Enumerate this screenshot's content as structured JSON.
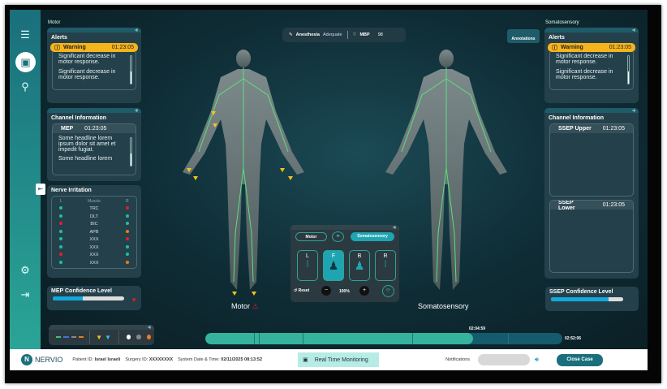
{
  "sidebar": {
    "items": [
      {
        "icon": "menu-icon"
      },
      {
        "icon": "monitor-icon",
        "active": true
      },
      {
        "icon": "search-analysis-icon"
      },
      {
        "icon": "user-settings-icon"
      },
      {
        "icon": "logout-icon"
      }
    ],
    "collapse_icon": "collapse-icon"
  },
  "vitals": {
    "anesthesia_label": "Anesthesia",
    "anesthesia_value": "Adequate",
    "mbp_label": "MBP",
    "mbp_value": "98"
  },
  "left": {
    "section_label": "Motor",
    "alerts": {
      "title": "Alerts",
      "level": "Warning",
      "time": "01:23:05",
      "messages": [
        "Significant decrease in motor response.",
        "Significant decrease in motor response."
      ]
    },
    "channel": {
      "title": "Channel Information",
      "name": "MEP",
      "time": "01:23:05",
      "lines": [
        "Some headline lorem ipsum dolor sit amet et impedit fugiat.",
        "Some headline lorem"
      ]
    },
    "nerve": {
      "title": "Nerve Irritation",
      "headers": [
        "L",
        "Muscle",
        "R"
      ],
      "rows": [
        {
          "l": "#1fbf9f",
          "m": "TRC",
          "r": "#e0202a"
        },
        {
          "l": "#1fbf9f",
          "m": "DLT",
          "r": "#1fbf9f"
        },
        {
          "l": "#e0202a",
          "m": "BIC",
          "r": "#1fbf9f"
        },
        {
          "l": "#1fbf9f",
          "m": "APB",
          "r": "#f07a18"
        },
        {
          "l": "#1fbf9f",
          "m": "XXX",
          "r": "#e0202a"
        },
        {
          "l": "#1fbf9f",
          "m": "XXX",
          "r": "#1fbf9f"
        },
        {
          "l": "#e0202a",
          "m": "XXX",
          "r": "#1fbf9f"
        },
        {
          "l": "#1fbf9f",
          "m": "XXX",
          "r": "#f07a18"
        }
      ]
    },
    "confidence": {
      "title": "MEP Confidence Level",
      "percent": 42
    }
  },
  "right": {
    "section_label": "Somatosensory",
    "annotations_label": "Annotations",
    "alerts": {
      "title": "Alerts",
      "level": "Warning",
      "time": "01:23:05",
      "messages": [
        "Significant decrease in motor response.",
        "Significant decrease in motor response."
      ]
    },
    "channel": {
      "title": "Channel Information",
      "upper": "SSEP Upper",
      "upper_time": "01:23:05",
      "lower": "SSEP Lower",
      "lower_time": "01:23:05"
    },
    "confidence": {
      "title": "SSEP Confidence Level",
      "percent": 80
    }
  },
  "figures": {
    "left_label": "Motor",
    "right_label": "Somatosensory"
  },
  "controls": {
    "motor": "Motor",
    "somato": "Somatosensory",
    "views": [
      "L",
      "F",
      "B",
      "R"
    ],
    "active_view": "F",
    "reset": "Reset",
    "zoom": "100%"
  },
  "legend": {
    "lines": [
      "#3ec46d",
      "#4a6fd6",
      "#888888",
      "#f07a18"
    ],
    "triangles": [
      "#f6c21c",
      "#3fc0d8"
    ],
    "dots": [
      "#ffffff",
      "#888888",
      "#f07a18"
    ]
  },
  "timeline": {
    "current": "02:04:59",
    "end": "02:52:06",
    "progress": 0.75
  },
  "footer": {
    "brand": "NERVIO",
    "patient_label": "Patient ID:",
    "patient": "Israel Israeli",
    "surgery_label": "Surgery ID:",
    "surgery": "XXXXXXXX",
    "datetime_label": "System Date & Time:",
    "datetime": "02/11/2025 08:13:52",
    "mode": "Real Time Monitoring",
    "notifications": "Notifications",
    "close": "Close Case"
  },
  "colors": {
    "teal": "#1a6f7c",
    "warning": "#f6b41c",
    "accent": "#2aa596"
  }
}
